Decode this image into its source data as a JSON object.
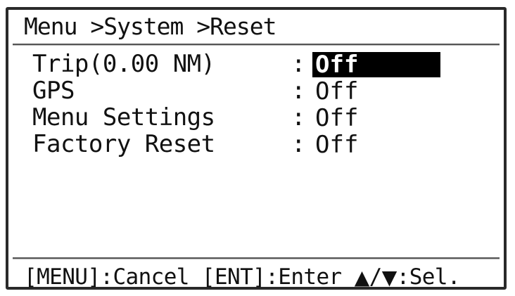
{
  "header": {
    "breadcrumb": "Menu >System >Reset"
  },
  "settings": [
    {
      "label": "Trip(0.00 NM)",
      "colon": ":",
      "value": "Off",
      "selected": true
    },
    {
      "label": "GPS",
      "colon": ":",
      "value": "Off",
      "selected": false
    },
    {
      "label": "Menu Settings",
      "colon": ":",
      "value": "Off",
      "selected": false
    },
    {
      "label": "Factory Reset",
      "colon": ":",
      "value": "Off",
      "selected": false
    }
  ],
  "footer": {
    "cancel_hint": "[MENU]:Cancel",
    "enter_hint": "[ENT]:Enter",
    "up_arrow": "▲",
    "slash": "/",
    "down_arrow": "▼",
    "select_hint": ":Sel."
  }
}
